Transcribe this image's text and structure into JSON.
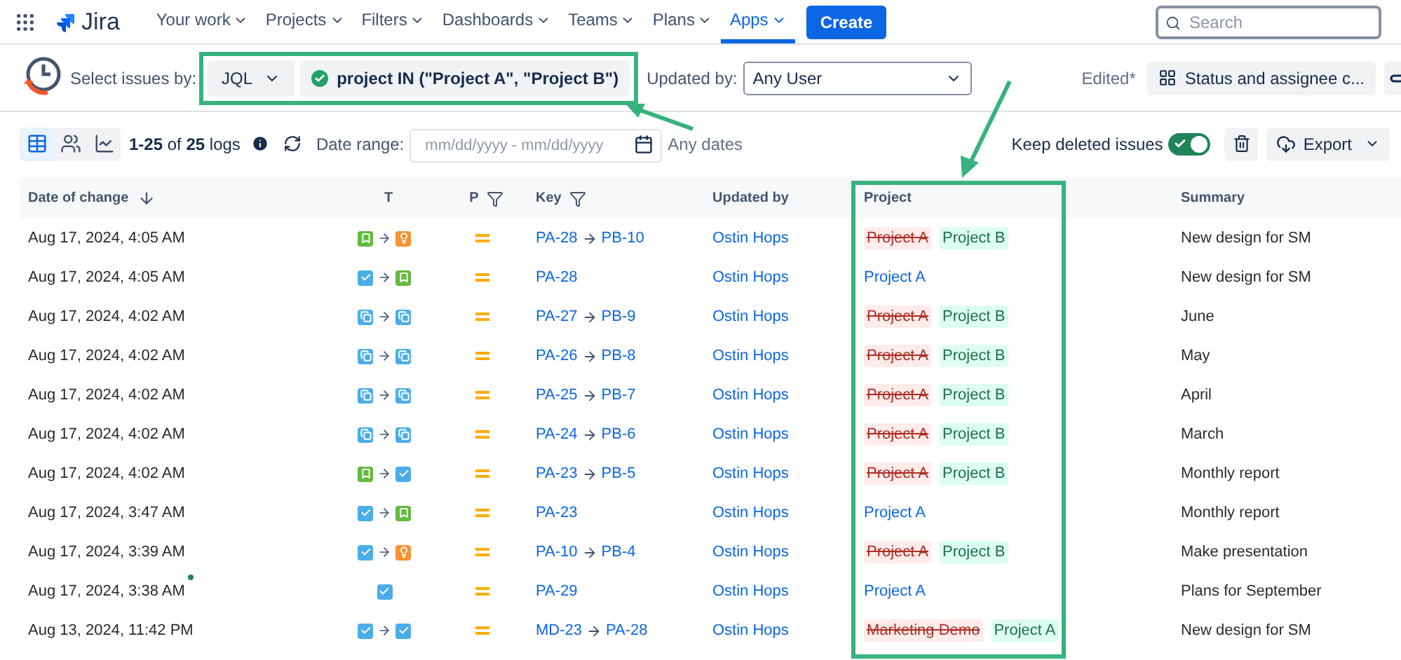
{
  "nav": {
    "logo": "Jira",
    "menus": [
      {
        "label": "Your work",
        "selected": false
      },
      {
        "label": "Projects",
        "selected": false
      },
      {
        "label": "Filters",
        "selected": false
      },
      {
        "label": "Dashboards",
        "selected": false
      },
      {
        "label": "Teams",
        "selected": false
      },
      {
        "label": "Plans",
        "selected": false
      },
      {
        "label": "Apps",
        "selected": true
      }
    ],
    "create": "Create",
    "search": {
      "placeholder": "Search"
    }
  },
  "filters": {
    "select_label": "Select issues by:",
    "mode": "JQL",
    "query": "project IN (\"Project A\", \"Project B\")",
    "updated_label": "Updated by:",
    "updated_value": "Any User",
    "edited": "Edited*",
    "view": "Status and assignee c..."
  },
  "toolbar": {
    "views": [
      {
        "kind": "table",
        "selected": true
      },
      {
        "kind": "users",
        "selected": false
      },
      {
        "kind": "chart",
        "selected": false
      }
    ],
    "count": "**1-25** of **25** logs",
    "date_label": "Date range:",
    "date_placeholder": "mm/dd/yyyy - mm/dd/yyyy",
    "any_dates": "Any dates",
    "keep_deleted": {
      "label": "Keep deleted issues",
      "on": true
    },
    "export": "Export"
  },
  "table": {
    "columns": [
      {
        "label": "Date of change",
        "sort": true,
        "filter": false
      },
      {
        "label": "T",
        "sort": false,
        "filter": false
      },
      {
        "label": "P",
        "sort": false,
        "filter": true
      },
      {
        "label": "Key",
        "sort": false,
        "filter": true
      },
      {
        "label": "Updated by",
        "sort": false,
        "filter": false
      },
      {
        "label": "Project",
        "sort": false,
        "filter": false
      },
      {
        "label": "Summary",
        "sort": false,
        "filter": false
      }
    ],
    "rows": [
      {
        "date": "Aug 17, 2024, 4:05 AM",
        "new": false,
        "types": [
          {
            "kind": "story"
          },
          {
            "kind": "idea"
          }
        ],
        "keys": [
          "PA-28",
          "PB-10"
        ],
        "user": "Ostin Hops",
        "projects": [
          "Project A",
          "Project B"
        ],
        "summary": "New design for SM"
      },
      {
        "date": "Aug 17, 2024, 4:05 AM",
        "new": false,
        "types": [
          {
            "kind": "task"
          },
          {
            "kind": "story"
          }
        ],
        "keys": [
          "PA-28"
        ],
        "user": "Ostin Hops",
        "projects": [
          "Project A"
        ],
        "summary": "New design for SM"
      },
      {
        "date": "Aug 17, 2024, 4:02 AM",
        "new": false,
        "types": [
          {
            "kind": "subtask"
          },
          {
            "kind": "subtask"
          }
        ],
        "keys": [
          "PA-27",
          "PB-9"
        ],
        "user": "Ostin Hops",
        "projects": [
          "Project A",
          "Project B"
        ],
        "summary": "June"
      },
      {
        "date": "Aug 17, 2024, 4:02 AM",
        "new": false,
        "types": [
          {
            "kind": "subtask"
          },
          {
            "kind": "subtask"
          }
        ],
        "keys": [
          "PA-26",
          "PB-8"
        ],
        "user": "Ostin Hops",
        "projects": [
          "Project A",
          "Project B"
        ],
        "summary": "May"
      },
      {
        "date": "Aug 17, 2024, 4:02 AM",
        "new": false,
        "types": [
          {
            "kind": "subtask"
          },
          {
            "kind": "subtask"
          }
        ],
        "keys": [
          "PA-25",
          "PB-7"
        ],
        "user": "Ostin Hops",
        "projects": [
          "Project A",
          "Project B"
        ],
        "summary": "April"
      },
      {
        "date": "Aug 17, 2024, 4:02 AM",
        "new": false,
        "types": [
          {
            "kind": "subtask"
          },
          {
            "kind": "subtask"
          }
        ],
        "keys": [
          "PA-24",
          "PB-6"
        ],
        "user": "Ostin Hops",
        "projects": [
          "Project A",
          "Project B"
        ],
        "summary": "March"
      },
      {
        "date": "Aug 17, 2024, 4:02 AM",
        "new": false,
        "types": [
          {
            "kind": "story"
          },
          {
            "kind": "task"
          }
        ],
        "keys": [
          "PA-23",
          "PB-5"
        ],
        "user": "Ostin Hops",
        "projects": [
          "Project A",
          "Project B"
        ],
        "summary": "Monthly report"
      },
      {
        "date": "Aug 17, 2024, 3:47 AM",
        "new": false,
        "types": [
          {
            "kind": "task"
          },
          {
            "kind": "story"
          }
        ],
        "keys": [
          "PA-23"
        ],
        "user": "Ostin Hops",
        "projects": [
          "Project A"
        ],
        "summary": "Monthly report"
      },
      {
        "date": "Aug 17, 2024, 3:39 AM",
        "new": false,
        "types": [
          {
            "kind": "task"
          },
          {
            "kind": "idea"
          }
        ],
        "keys": [
          "PA-10",
          "PB-4"
        ],
        "user": "Ostin Hops",
        "projects": [
          "Project A",
          "Project B"
        ],
        "summary": "Make presentation"
      },
      {
        "date": "Aug 17, 2024, 3:38 AM",
        "new": true,
        "types": [
          {
            "kind": "task"
          }
        ],
        "keys": [
          "PA-29"
        ],
        "user": "Ostin Hops",
        "projects": [
          "Project A"
        ],
        "summary": "Plans for September"
      },
      {
        "date": "Aug 13, 2024, 11:42 PM",
        "new": false,
        "types": [
          {
            "kind": "task"
          },
          {
            "kind": "task"
          }
        ],
        "keys": [
          "MD-23",
          "PA-28"
        ],
        "user": "Ostin Hops",
        "projects": [
          "Marketing Demo",
          "Project A"
        ],
        "summary": "New design for SM"
      }
    ]
  }
}
